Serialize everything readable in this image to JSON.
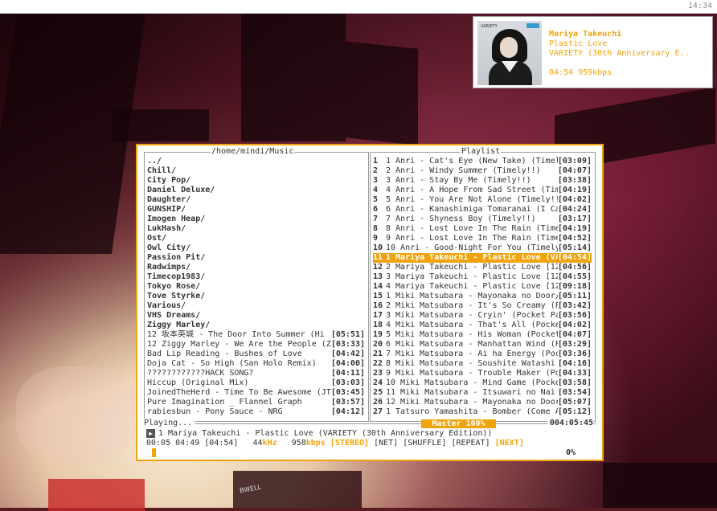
{
  "topbar": {
    "clock": "14:34"
  },
  "notification": {
    "artist": "Mariya Takeuchi",
    "title": "Plastic Love",
    "album": "VARIETY (30th Anniversary E..",
    "meta": "04:54 959kbps",
    "cover_label": "VARIETY"
  },
  "library": {
    "title": "/home/mindi/Music",
    "dirs": [
      "../",
      "Chill/",
      "City Pop/",
      "Daniel Deluxe/",
      "Daughter/",
      "GUNSHIP/",
      "Imogen Heap/",
      "LukHash/",
      "Ost/",
      "Owl City/",
      "Passion Pit/",
      "Radwimps/",
      "Timecop1983/",
      "Tokyo Rose/",
      "Tove Styrke/",
      "Various/",
      "VHS Dreams/",
      "Ziggy Marley/"
    ],
    "files": [
      {
        "title": "12 坂本英城 - The Door Into Summer (Hi",
        "dur": "[05:51]"
      },
      {
        "title": "12 Ziggy Marley - We Are the People (Z",
        "dur": "[03:33]"
      },
      {
        "title": "Bad Lip Reading - Bushes of Love",
        "dur": "[04:42]"
      },
      {
        "title": "Doja Cat - So High (San Holo Remix)",
        "dur": "[04:00]"
      },
      {
        "title": "????????????HACK SONG?",
        "dur": "[04:11]"
      },
      {
        "title": "Hiccup (Original Mix)",
        "dur": "[03:03]"
      },
      {
        "title": "JoinedTheHerd - Time To Be Awesome (JT",
        "dur": "[03:45]"
      },
      {
        "title": "Pure Imagination _ Flannel Graph",
        "dur": "[03:57]"
      },
      {
        "title": "rabiesbun - Pony Sauce - NRG",
        "dur": "[04:12]"
      }
    ]
  },
  "playlist": {
    "title": "Playlist",
    "active_index": 10,
    "rows": [
      {
        "n": "1",
        "title": "1 Anri - Cat's Eye (New Take) (Timel",
        "dur": "[03:09]"
      },
      {
        "n": "2",
        "title": "2 Anri - Windy Summer (Timely!!)",
        "dur": "[04:07]"
      },
      {
        "n": "3",
        "title": "3 Anri - Stay By Me (Timely!!)",
        "dur": "[03:38]"
      },
      {
        "n": "4",
        "title": "4 Anri - A Hope From Sad Street (Tim",
        "dur": "[04:19]"
      },
      {
        "n": "5",
        "title": "5 Anri - You Are Not Alone (Timely!!",
        "dur": "[04:02]"
      },
      {
        "n": "6",
        "title": "6 Anri - Kanashimiga Tomaranai (I Ca",
        "dur": "[04:24]"
      },
      {
        "n": "7",
        "title": "7 Anri - Shyness Boy (Timely!!)",
        "dur": "[03:17]"
      },
      {
        "n": "8",
        "title": "8 Anri - Lost Love In The Rain (Time",
        "dur": "[04:19]"
      },
      {
        "n": "9",
        "title": "9 Anri - Lost Love In The Rain (Time",
        "dur": "[04:52]"
      },
      {
        "n": "10",
        "title": "10 Anri - Good-Night For You (Timely",
        "dur": "[05:14]"
      },
      {
        "n": "11",
        "title": "1 Mariya Takeuchi - Plastic Love (VA",
        "dur": "[04:54]"
      },
      {
        "n": "12",
        "title": "2 Mariya Takeuchi - Plastic Love [12",
        "dur": "[04:56]"
      },
      {
        "n": "13",
        "title": "3 Mariya Takeuchi - Plastic Love [12",
        "dur": "[04:55]"
      },
      {
        "n": "14",
        "title": "4 Mariya Takeuchi - Plastic Love [12",
        "dur": "[09:18]"
      },
      {
        "n": "15",
        "title": "1 Miki Matsubara - Mayonaka no Door/",
        "dur": "[05:11]"
      },
      {
        "n": "16",
        "title": "2 Miki Matsubara - It's So Creamy (P",
        "dur": "[03:42]"
      },
      {
        "n": "17",
        "title": "3 Miki Matsubara - Cryin' (Pocket Pa",
        "dur": "[03:56]"
      },
      {
        "n": "18",
        "title": "4 Miki Matsubara - That's All (Pocke",
        "dur": "[04:02]"
      },
      {
        "n": "19",
        "title": "5 Miki Matsubara - His Woman (Pocket",
        "dur": "[04:07]"
      },
      {
        "n": "20",
        "title": "6 Miki Matsubara - Manhattan Wind (P",
        "dur": "[03:29]"
      },
      {
        "n": "21",
        "title": "7 Miki Matsubara - Ai ha Energy (Poc",
        "dur": "[03:36]"
      },
      {
        "n": "22",
        "title": "8 Miki Matsubara - Soushite Watashi (",
        "dur": "[04:16]"
      },
      {
        "n": "23",
        "title": "9 Miki Matsubara - Trouble Maker (Po",
        "dur": "[04:33]"
      },
      {
        "n": "24",
        "title": "10 Miki Matsubara - Mind Game (Pocke",
        "dur": "[03:58]"
      },
      {
        "n": "25",
        "title": "11 Miki Matsubara - Itsuwari no Nai",
        "dur": "[03:54]"
      },
      {
        "n": "26",
        "title": "12 Miki Matsubara - Mayonaka no Door",
        "dur": "[05:07]"
      },
      {
        "n": "27",
        "title": "1 Tatsuro Yamashita - Bomber (Come A",
        "dur": "[05:12]"
      }
    ]
  },
  "status": {
    "playing_label": "Playing...",
    "volume": "Master 100%",
    "total_time": "004:05:45",
    "track": "1 Mariya Takeuchi - Plastic Love (VARIETY (30th Anniversary Edition))",
    "position": "00:05",
    "remaining": "04:49",
    "duration": "[04:54]",
    "khz": "44",
    "khz_unit": "kHz",
    "kbps": "958",
    "kbps_unit": "kbps",
    "stereo": "[STEREO]",
    "net": "[NET]",
    "shuffle": "[SHUFFLE]",
    "repeat": "[REPEAT]",
    "next": "[NEXT]",
    "percent": "0%"
  },
  "wallpaper": {
    "sign_text": "BWELL"
  },
  "colors": {
    "accent": "#f0a30a",
    "text": "#333333",
    "border": "#9a9a9a"
  }
}
